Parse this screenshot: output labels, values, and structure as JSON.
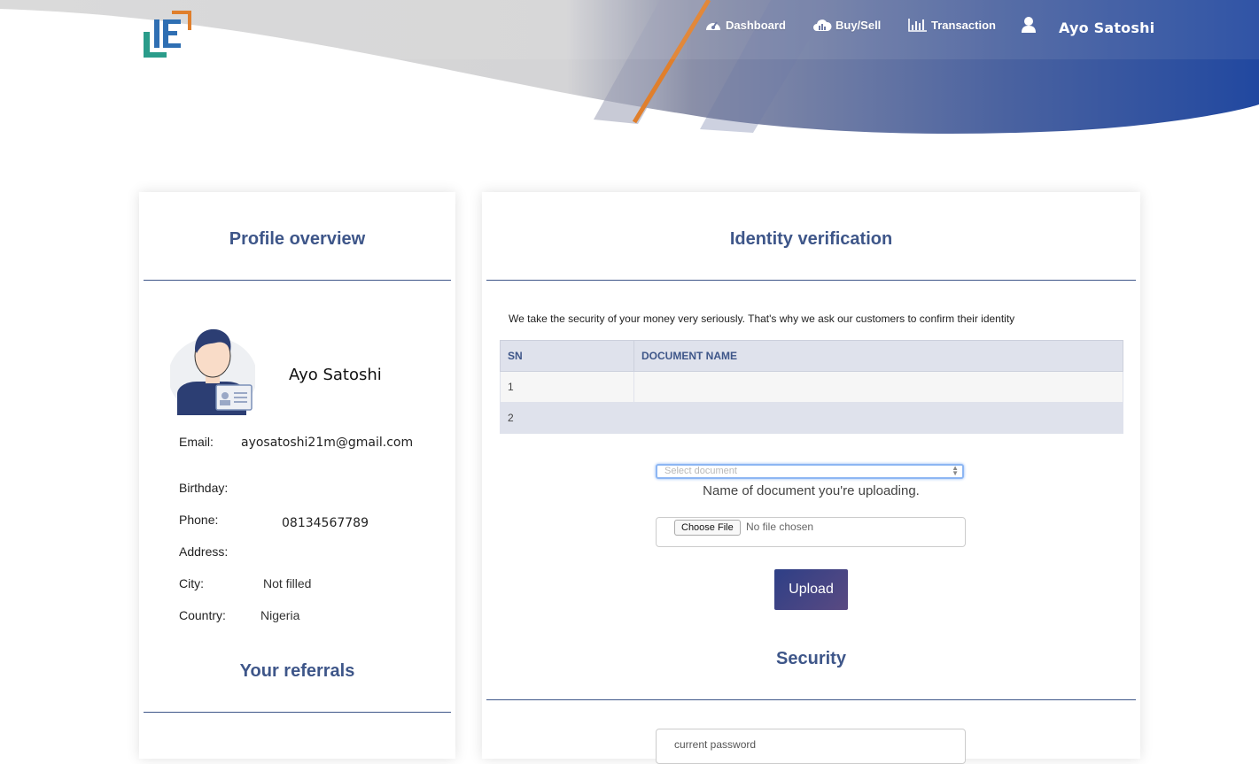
{
  "nav": {
    "items": [
      {
        "label": "Dashboard",
        "icon": "dashboard-icon"
      },
      {
        "label": "Buy/Sell",
        "icon": "cloud-chart-icon"
      },
      {
        "label": "Transaction",
        "icon": "bar-chart-icon"
      }
    ],
    "user_name": "Ayo Satoshi",
    "user_icon": "user-icon"
  },
  "colors": {
    "accent": "#3e5689",
    "header_blue": "#2a4fa0",
    "header_orange": "#e07f2c",
    "upload_button": "#3a4584"
  },
  "profile": {
    "title": "Profile overview",
    "name": "Ayo Satoshi",
    "fields": [
      {
        "label": "Email:",
        "value": "ayosatoshi21m@gmail.com"
      },
      {
        "label": "Birthday:",
        "value": ""
      },
      {
        "label": "Phone:",
        "value": "08134567789"
      },
      {
        "label": "Address:",
        "value": ""
      },
      {
        "label": "City:",
        "value": "Not filled"
      },
      {
        "label": "Country:",
        "value": "Nigeria"
      }
    ],
    "referrals_title": "Your referrals"
  },
  "verification": {
    "title": "Identity verification",
    "intro": "We take the security of your money very seriously. That's why we ask our customers to confirm their identity",
    "table": {
      "headers": [
        "SN",
        "DOCUMENT NAME"
      ],
      "rows": [
        [
          "1",
          ""
        ],
        [
          "2",
          ""
        ]
      ]
    },
    "select_placeholder": "Select document",
    "helper": "Name of document you're uploading.",
    "file_button": "Choose File",
    "file_status": "No file chosen",
    "upload_label": "Upload"
  },
  "security": {
    "title": "Security",
    "password_placeholder": "current password"
  }
}
